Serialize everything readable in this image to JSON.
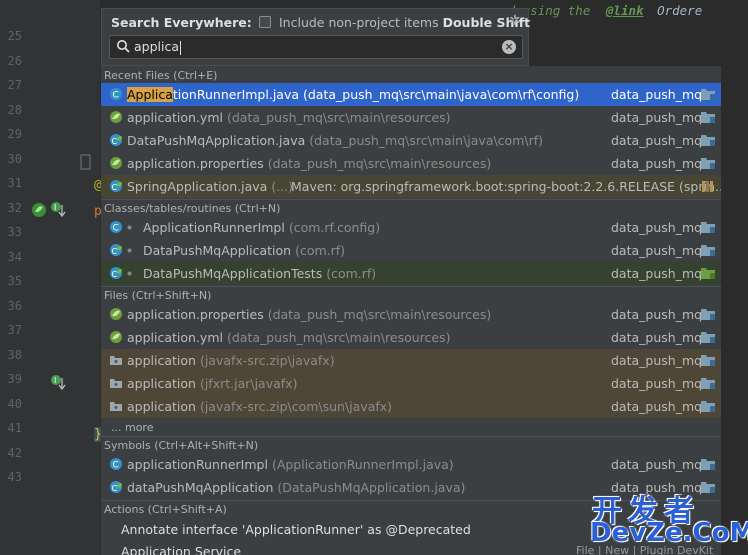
{
  "editor": {
    "line_numbers": [
      "25",
      "26",
      "27",
      "28",
      "29",
      "30",
      "31",
      "32",
      "33",
      "34",
      "35",
      "36",
      "37",
      "38",
      "39",
      "40",
      "41",
      "42",
      "43"
    ],
    "code_top_italic": "ered using the",
    "code_top_link": "@link",
    "code_top_tail": "Ordere",
    "code_line_at": "@",
    "code_line_p": "p",
    "code_brace": "}"
  },
  "popup": {
    "title": "Search Everywhere:",
    "include_label": "Include non-project items",
    "include_shortcut": "Double Shift",
    "search_value": "applica",
    "include_checked": false
  },
  "sections": {
    "recent": "Recent Files (Ctrl+E)",
    "classes": "Classes/tables/routines (Ctrl+N)",
    "files": "Files (Ctrl+Shift+N)",
    "symbols": "Symbols (Ctrl+Alt+Shift+N)",
    "actions": "Actions (Ctrl+Shift+A)"
  },
  "recent_files": [
    {
      "name_hl": "Applica",
      "name_rest": "tionRunnerImpl.java",
      "path": "(data_push_mq\\src\\main\\java\\com\\rf\\config)",
      "module": "data_push_mq",
      "icon": "class-icon"
    },
    {
      "name_hl": "",
      "name_rest": "application.yml",
      "path": "(data_push_mq\\src\\main\\resources)",
      "module": "data_push_mq",
      "icon": "spring-config-icon"
    },
    {
      "name_hl": "",
      "name_rest": "DataPushMqApplication.java",
      "path": "(data_push_mq\\src\\main\\java\\com\\rf)",
      "module": "data_push_mq",
      "icon": "spring-class-icon"
    },
    {
      "name_hl": "",
      "name_rest": "application.properties",
      "path": "(data_push_mq\\src\\main\\resources)",
      "module": "data_push_mq",
      "icon": "spring-config-icon"
    },
    {
      "name_hl": "",
      "name_rest": "SpringApplication.java",
      "path": "(...)",
      "module": "Maven: org.springframework.boot:spring-boot:2.2.6.RELEASE (sprin…",
      "icon": "spring-class-icon"
    }
  ],
  "classes": [
    {
      "name": "ApplicationRunnerImpl",
      "path": "(com.rf.config)",
      "module": "data_push_mq"
    },
    {
      "name": "DataPushMqApplication",
      "path": "(com.rf)",
      "module": "data_push_mq"
    },
    {
      "name": "DataPushMqApplicationTests",
      "path": "(com.rf)",
      "module": "data_push_mq"
    }
  ],
  "files": [
    {
      "name": "application.properties",
      "path": "(data_push_mq\\src\\main\\resources)",
      "module": "data_push_mq"
    },
    {
      "name": "application.yml",
      "path": "(data_push_mq\\src\\main\\resources)",
      "module": "data_push_mq"
    },
    {
      "name": "application",
      "path": "(javafx-src.zip\\javafx)",
      "module": "data_push_mq"
    },
    {
      "name": "application",
      "path": "(jfxrt.jar\\javafx)",
      "module": "data_push_mq"
    },
    {
      "name": "application",
      "path": "(javafx-src.zip\\com\\sun\\javafx)",
      "module": "data_push_mq"
    }
  ],
  "more_label": "... more",
  "symbols": [
    {
      "name": "applicationRunnerImpl",
      "path": "(ApplicationRunnerImpl.java)",
      "module": "data_push_mq"
    },
    {
      "name": "dataPushMqApplication",
      "path": "(DataPushMqApplication.java)",
      "module": "data_push_mq"
    }
  ],
  "actions": [
    {
      "label": "Annotate interface 'ApplicationRunner' as @Deprecated"
    },
    {
      "label": "Application Service"
    }
  ],
  "action_path": "File | New | Plugin DevKit",
  "watermark": {
    "cn": "开发者",
    "en": "DevZe.CoM"
  },
  "colors": {
    "selection": "#2f65ca",
    "highlight": "#d9a343",
    "panel": "#3c3f41",
    "editor": "#2b2b2b"
  }
}
